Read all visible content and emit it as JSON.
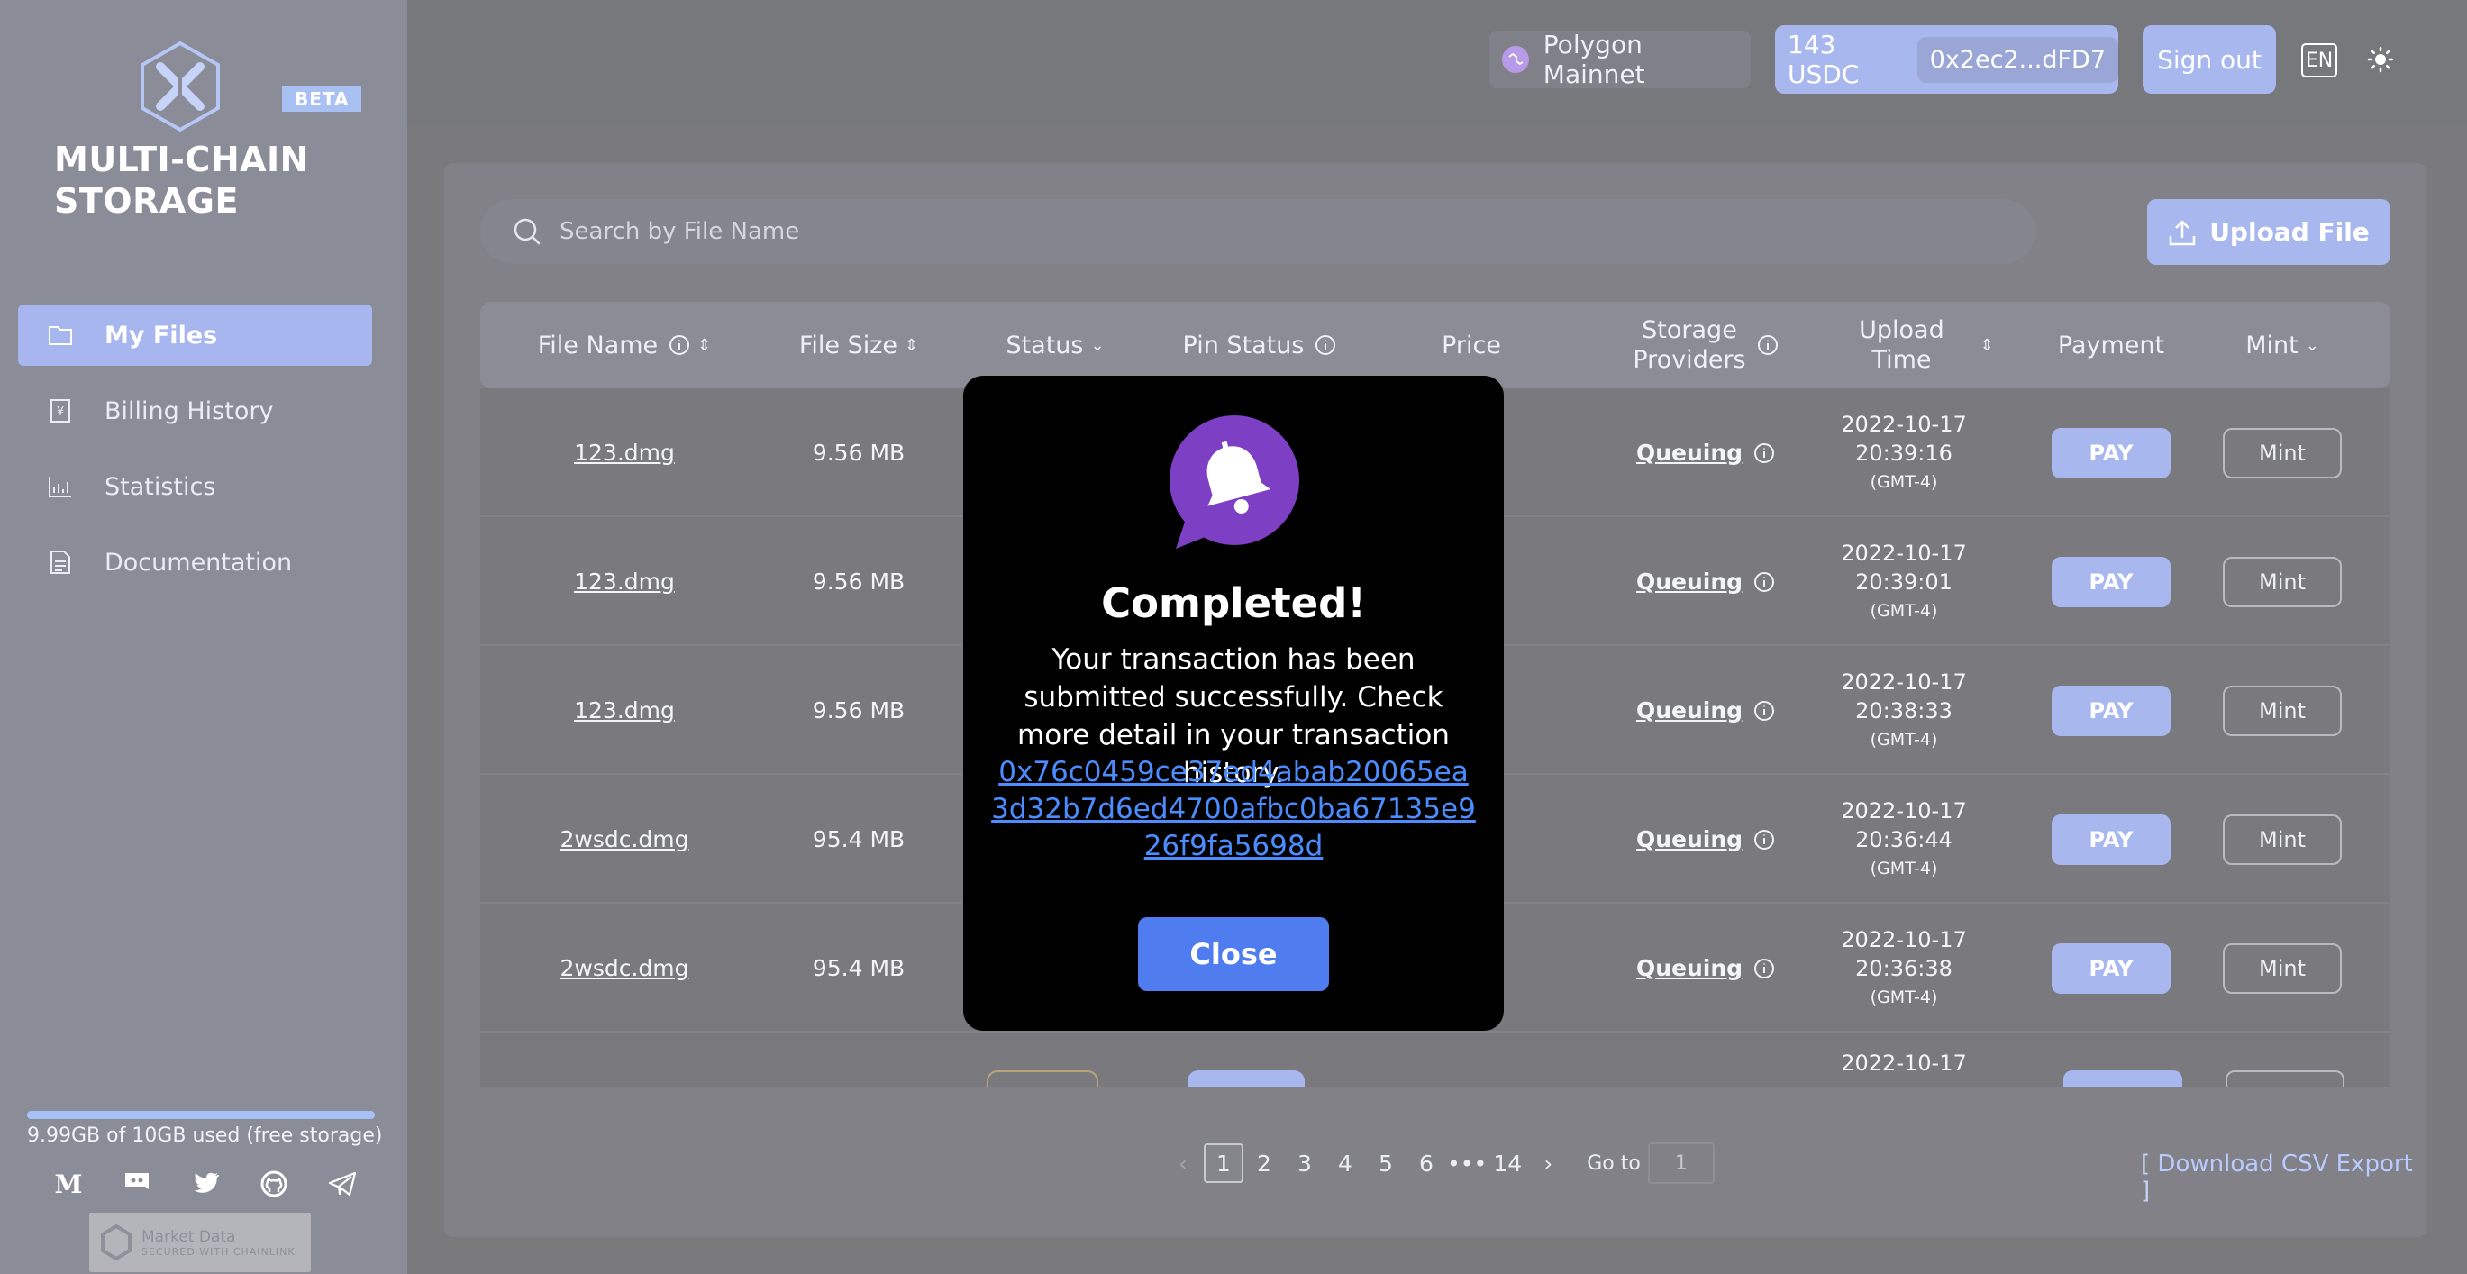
{
  "sidebar": {
    "beta": "BETA",
    "brand_line1": "MULTI-CHAIN",
    "brand_line2": "STORAGE",
    "items": [
      {
        "label": "My Files",
        "icon": "folder-icon"
      },
      {
        "label": "Billing History",
        "icon": "billing-icon"
      },
      {
        "label": "Statistics",
        "icon": "chart-icon"
      },
      {
        "label": "Documentation",
        "icon": "document-icon"
      }
    ],
    "storage_used_fraction": 0.999,
    "storage_text": "9.99GB of 10GB used (free storage)",
    "socials": [
      "medium-icon",
      "discord-icon",
      "twitter-icon",
      "github-icon",
      "telegram-icon"
    ],
    "chainlink_title": "Market Data",
    "chainlink_sub": "SECURED WITH CHAINLINK"
  },
  "header": {
    "network": "Polygon Mainnet",
    "balance": "143 USDC",
    "address": "0x2ec2...dFD7",
    "signout": "Sign out",
    "lang": "EN"
  },
  "main": {
    "search_placeholder": "Search by File Name",
    "upload_label": "Upload File",
    "columns": {
      "file_name": "File Name",
      "file_size": "File Size",
      "status": "Status",
      "pin_status": "Pin Status",
      "price": "Price",
      "storage_providers_1": "Storage",
      "storage_providers_2": "Providers",
      "upload_time_1": "Upload",
      "upload_time_2": "Time",
      "payment": "Payment",
      "mint": "Mint"
    },
    "rows": [
      {
        "name": "123.dmg",
        "size": "9.56 MB",
        "providers": "Queuing",
        "date": "2022-10-17",
        "time": "20:39:16",
        "tz": "(GMT-4)",
        "pay": "PAY",
        "mint": "Mint"
      },
      {
        "name": "123.dmg",
        "size": "9.56 MB",
        "providers": "Queuing",
        "date": "2022-10-17",
        "time": "20:39:01",
        "tz": "(GMT-4)",
        "pay": "PAY",
        "mint": "Mint"
      },
      {
        "name": "123.dmg",
        "size": "9.56 MB",
        "providers": "Queuing",
        "date": "2022-10-17",
        "time": "20:38:33",
        "tz": "(GMT-4)",
        "pay": "PAY",
        "mint": "Mint"
      },
      {
        "name": "2wsdc.dmg",
        "size": "95.4 MB",
        "providers": "Queuing",
        "date": "2022-10-17",
        "time": "20:36:44",
        "tz": "(GMT-4)",
        "pay": "PAY",
        "mint": "Mint"
      },
      {
        "name": "2wsdc.dmg",
        "size": "95.4 MB",
        "providers": "Queuing",
        "date": "2022-10-17",
        "time": "20:36:38",
        "tz": "(GMT-4)",
        "pay": "PAY",
        "mint": "Mint"
      },
      {
        "name": "",
        "size": "",
        "providers": "",
        "date": "2022-10-17",
        "time": "",
        "tz": "",
        "pay": "",
        "mint": ""
      }
    ],
    "pagination": {
      "pages": [
        "1",
        "2",
        "3",
        "4",
        "5",
        "6",
        "•••",
        "14"
      ],
      "current": "1",
      "goto_label": "Go to",
      "goto_value": "1"
    },
    "csv_open": "[",
    "csv_label": "Download CSV Export",
    "csv_close": "]"
  },
  "modal": {
    "title": "Completed!",
    "body": "Your transaction has been submitted successfully. Check more detail in your transaction history.",
    "hash": "0x76c0459ce37ed4abab20065ea3d32b7d6ed4700afbc0ba67135e926f9fa5698d",
    "close": "Close"
  }
}
